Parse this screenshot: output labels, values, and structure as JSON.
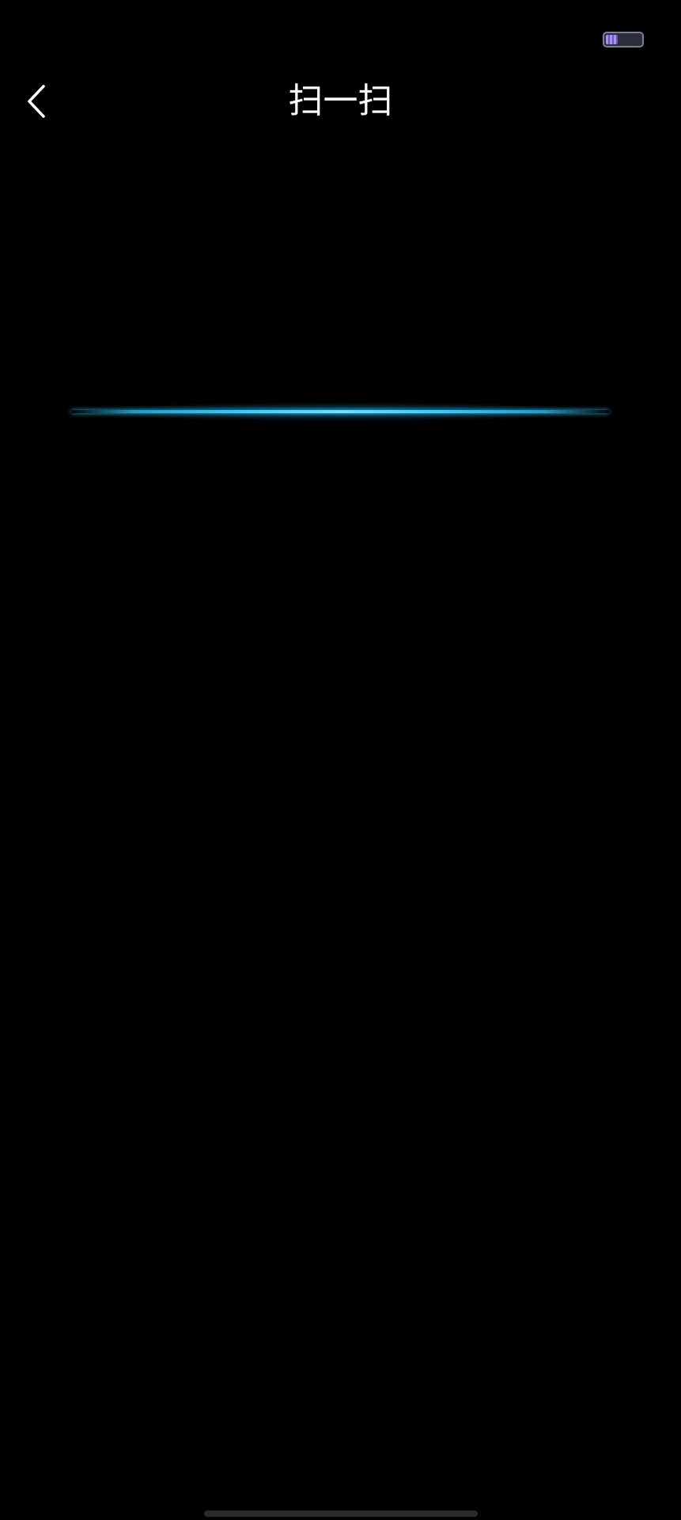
{
  "status_bar": {
    "battery": {
      "level": 0.35,
      "icon": "battery-icon",
      "fill_color": "#a58ff0"
    }
  },
  "nav": {
    "back_icon": "chevron-left-icon",
    "title": "扫一扫"
  },
  "scanner": {
    "line_color": "#3fd0ff"
  },
  "colors": {
    "background": "#000000",
    "title_text": "#ffffff"
  }
}
